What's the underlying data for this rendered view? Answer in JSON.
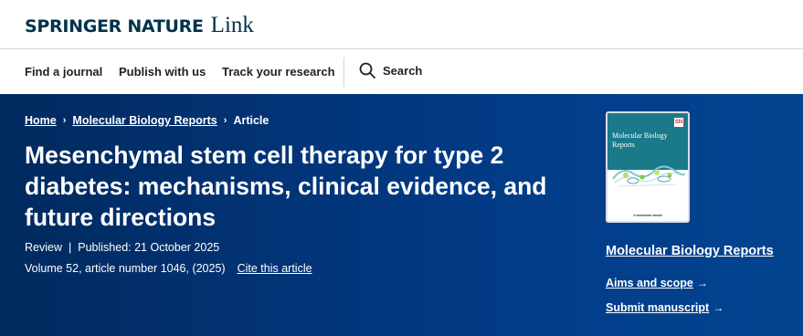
{
  "header": {
    "logo_main": "SPRINGER NATURE",
    "logo_link": "Link"
  },
  "nav": {
    "items": [
      {
        "label": "Find a journal"
      },
      {
        "label": "Publish with us"
      },
      {
        "label": "Track your research"
      }
    ],
    "search_label": "Search",
    "search_icon": "search-icon"
  },
  "breadcrumb": {
    "home": "Home",
    "journal": "Molecular Biology Reports",
    "current": "Article"
  },
  "article": {
    "title": "Mesenchymal stem cell therapy for type 2 diabetes: mechanisms, clinical evidence, and future directions",
    "type": "Review",
    "published": "Published: 21 October 2025",
    "volume": "Volume 52, article number 1046, (2025)",
    "cite_label": "Cite this article"
  },
  "journal": {
    "cover_title": "Molecular Biology Reports",
    "cover_badge": "SN",
    "name": "Molecular Biology Reports",
    "aims_label": "Aims and scope",
    "submit_label": "Submit manuscript"
  },
  "colors": {
    "hero_bg": "#02357a",
    "brand": "#01324b",
    "cover_accent": "#1a7a8a"
  }
}
